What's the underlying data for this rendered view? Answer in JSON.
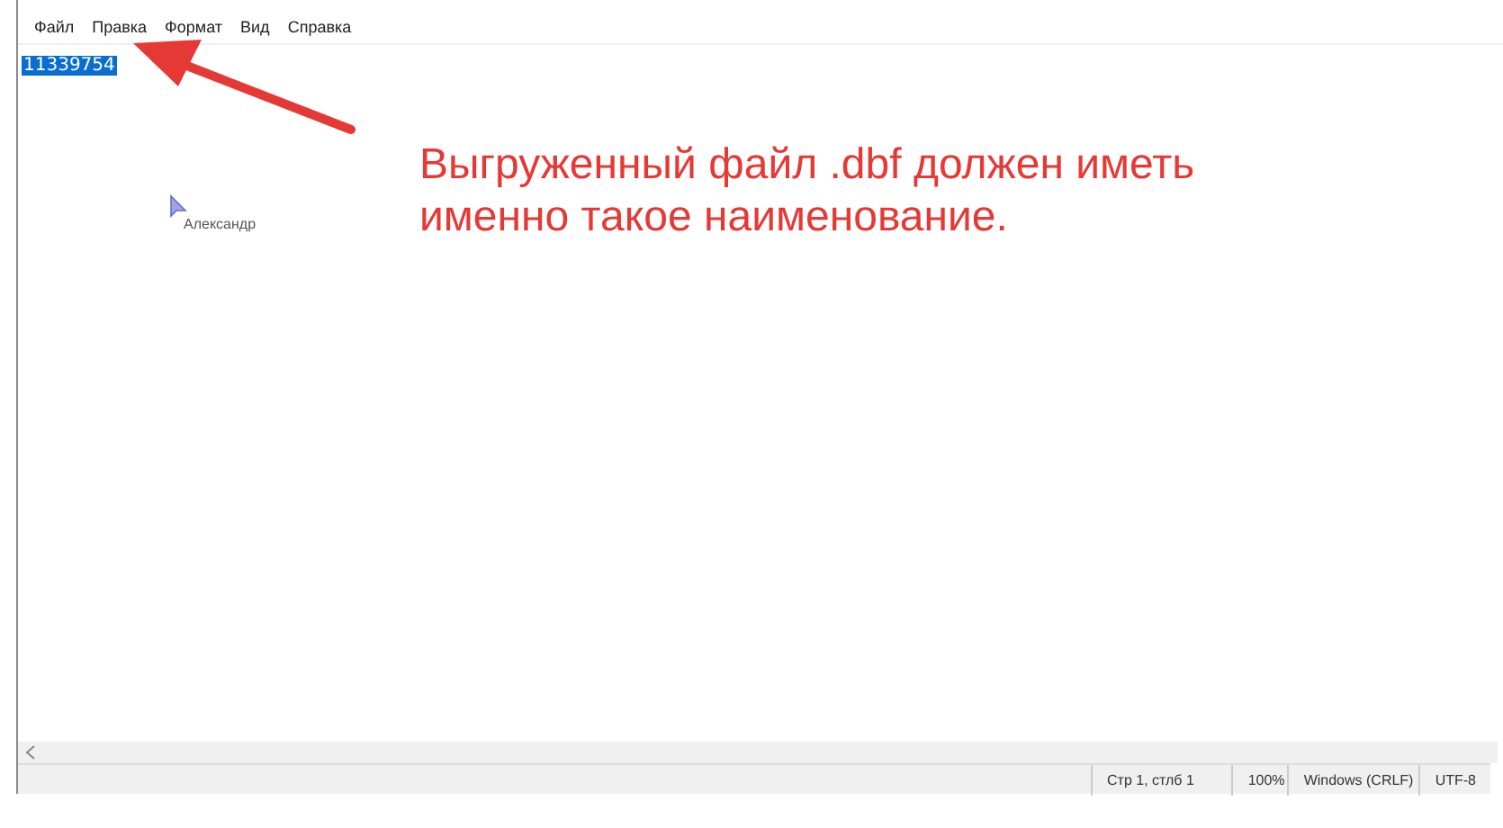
{
  "menu": [
    {
      "label": "Файл"
    },
    {
      "label": "Правка"
    },
    {
      "label": "Формат"
    },
    {
      "label": "Вид"
    },
    {
      "label": "Справка"
    }
  ],
  "document": {
    "text": "11339754",
    "selected": true
  },
  "cursor": {
    "label": "Александр"
  },
  "annotation": {
    "text": "Выгруженный файл .dbf должен иметь именно такое наименование."
  },
  "status_bar": [
    {
      "text": "Стр 1, стлб 1"
    },
    {
      "text": "100%"
    },
    {
      "text": "Windows (CRLF)"
    },
    {
      "text": "UTF-8"
    }
  ]
}
